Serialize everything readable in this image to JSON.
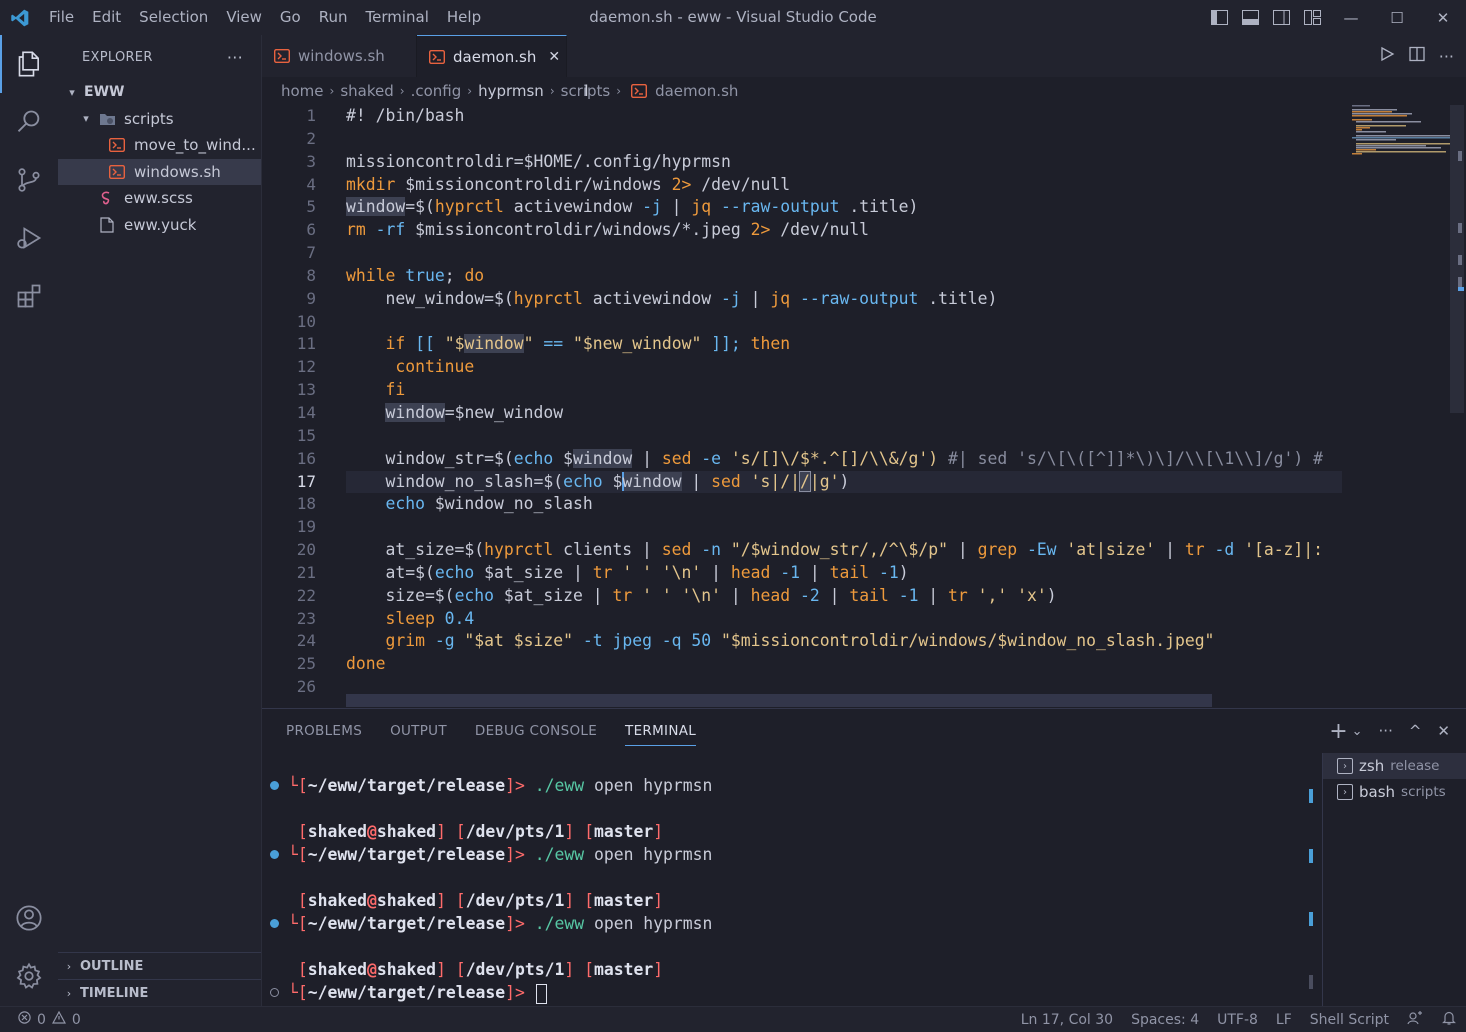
{
  "window": {
    "title": "daemon.sh - eww - Visual Studio Code",
    "menu": [
      "File",
      "Edit",
      "Selection",
      "View",
      "Go",
      "Run",
      "Terminal",
      "Help"
    ],
    "controls": {
      "minimize": "—",
      "maximize": "☐",
      "close": "✕"
    }
  },
  "sidebar": {
    "header": "EXPLORER",
    "more": "···",
    "root": "EWW",
    "items": [
      {
        "label": "scripts",
        "type": "folder"
      },
      {
        "label": "move_to_wind...",
        "type": "shell"
      },
      {
        "label": "windows.sh",
        "type": "shell"
      },
      {
        "label": "eww.scss",
        "type": "sass"
      },
      {
        "label": "eww.yuck",
        "type": "file"
      }
    ],
    "sections": [
      "OUTLINE",
      "TIMELINE"
    ]
  },
  "tabs": [
    {
      "label": "windows.sh",
      "active": false
    },
    {
      "label": "daemon.sh",
      "active": true,
      "close": "✕"
    }
  ],
  "breadcrumb": [
    "home",
    "shaked",
    ".config",
    "hyprmsn",
    "scripts",
    "daemon.sh"
  ],
  "editor": {
    "current_line": 17,
    "lines": [
      "1",
      "2",
      "3",
      "4",
      "5",
      "6",
      "7",
      "8",
      "9",
      "10",
      "11",
      "12",
      "13",
      "14",
      "15",
      "16",
      "17",
      "18",
      "19",
      "20",
      "21",
      "22",
      "23",
      "24",
      "25",
      "26"
    ],
    "code": {
      "l1": "#! /bin/bash",
      "l3": "missioncontroldir=$HOME/.config/hyprmsn",
      "l4_cmd": "mkdir",
      "l4_rest": " $missioncontroldir/windows ",
      "l4_redir": "2>",
      "l4_tail": " /dev/null",
      "l5_var": "window",
      "l5_eq": "=$(",
      "l5_cmd": "hyprctl",
      "l5_a1": " activewindow ",
      "l5_flag": "-j",
      "l5_pipe": " | ",
      "l5_jq": "jq",
      "l5_flag2": " --raw-output",
      "l5_tail": " .title)",
      "l6_cmd": "rm",
      "l6_flag": " -rf",
      "l6_rest": " $missioncontroldir/windows/*.jpeg ",
      "l6_redir": "2>",
      "l6_tail": " /dev/null",
      "l8_while": "while",
      "l8_true": " true",
      "l8_semi": "; ",
      "l8_do": "do",
      "l9_pre": "    new_window=$(",
      "l9_cmd": "hyprctl",
      "l9_a1": " activewindow ",
      "l9_flag": "-j",
      "l9_pipe": " | ",
      "l9_jq": "jq",
      "l9_flag2": " --raw-output",
      "l9_tail": " .title)",
      "l11_if": "    if",
      "l11_b1": " [[ ",
      "l11_s1": "\"$",
      "l11_hl": "window",
      "l11_s2": "\"",
      "l11_op": " == ",
      "l11_s3": "\"$new_window\"",
      "l11_b2": " ]]; ",
      "l11_then": "then",
      "l12": "     continue",
      "l13": "    fi",
      "l14_pre": "    ",
      "l14_hl": "window",
      "l14_tail": "=$new_window",
      "l16_pre": "    window_str=$(",
      "l16_echo": "echo",
      "l16_v": " $",
      "l16_hl": "window",
      "l16_pipe": " | ",
      "l16_sed": "sed",
      "l16_flag": " -e",
      "l16_str": " 's/[]\\/$*.^[]/\\\\&/g')",
      "l16_comment": " #| sed 's/\\[\\([^]]*\\)\\]/\\\\[\\1\\\\]/g') #",
      "l17_pre": "    window_no_slash=$(",
      "l17_echo": "echo",
      "l17_v": " $",
      "l17_hl": "window",
      "l17_pipe": " | ",
      "l17_sed": "sed",
      "l17_str": " 's|/|",
      "l17_hl2": "/",
      "l17_str2": "|g'",
      "l17_tail": ")",
      "l18_echo": "    echo",
      "l18_tail": " $window_no_slash",
      "l20_pre": "    at_size=$(",
      "l20_cmd": "hyprctl",
      "l20_a1": " clients",
      "l20_pipe": " | ",
      "l20_sed": "sed",
      "l20_flag": " -n",
      "l20_str": " \"/$window_str/,/^\\$/p\"",
      "l20_pipe2": " | ",
      "l20_grep": "grep",
      "l20_flag2": " -Ew",
      "l20_str2": " 'at|size'",
      "l20_pipe3": " | ",
      "l20_tr": "tr",
      "l20_flag3": " -d",
      "l20_str3": " '[a-z]|:",
      "l21_pre": "    at=$(",
      "l21_echo": "echo",
      "l21_v": " $at_size",
      "l21_pipe": " | ",
      "l21_tr": "tr",
      "l21_str": " ' ' '\\n'",
      "l21_pipe2": " | ",
      "l21_head": "head",
      "l21_n": " -1",
      "l21_pipe3": " | ",
      "l21_tail": "tail",
      "l21_n2": " -1",
      "l21_end": ")",
      "l22_pre": "    size=$(",
      "l22_echo": "echo",
      "l22_v": " $at_size",
      "l22_pipe": " | ",
      "l22_tr": "tr",
      "l22_str": " ' ' '\\n'",
      "l22_pipe2": " | ",
      "l22_head": "head",
      "l22_n": " -2",
      "l22_pipe3": " | ",
      "l22_tail": "tail",
      "l22_n2": " -1",
      "l22_pipe4": " | ",
      "l22_tr2": "tr",
      "l22_str2": " ',' 'x'",
      "l22_end": ")",
      "l23_sleep": "    sleep",
      "l23_n": " 0.4",
      "l24_grim": "    grim",
      "l24_f1": " -g",
      "l24_s1": " \"$at $size\"",
      "l24_f2": " -t",
      "l24_jpeg": " jpeg",
      "l24_f3": " -q",
      "l24_n": " 50",
      "l24_s2": " \"$missioncontroldir/windows/$window_no_slash.jpeg\"",
      "l25": "done"
    }
  },
  "panel": {
    "tabs": [
      "PROBLEMS",
      "OUTPUT",
      "DEBUG CONSOLE",
      "TERMINAL"
    ],
    "active_tab": "TERMINAL",
    "actions": {
      "add": "+",
      "dropdown": "⌄",
      "more": "···",
      "maximize": "^",
      "close": "✕"
    },
    "terminal_lines": {
      "p_open": "└[",
      "path": "~/eww/target/release",
      "p_close": "]>",
      "cmd_bin": " ./eww",
      "cmd_args": " open hyprmsn",
      "b_open": "[",
      "user": "shaked",
      "at": "@",
      "host": "shaked",
      "b_close": "]",
      "tty_open": " [",
      "tty": "/dev/pts/1",
      "tty_close": "]",
      "branch_open": " [",
      "branch": "master",
      "branch_close": "]",
      "cursor": " "
    },
    "terminal_list": [
      {
        "shell": "zsh",
        "name": "release",
        "selected": true
      },
      {
        "shell": "bash",
        "name": "scripts",
        "selected": false
      }
    ]
  },
  "statusbar": {
    "errors": "0",
    "warnings": "0",
    "position": "Ln 17, Col 30",
    "spaces": "Spaces: 4",
    "encoding": "UTF-8",
    "eol": "LF",
    "language": "Shell Script"
  },
  "colors": {
    "accent": "#5aa0e6",
    "keyword": "#ee9a3c",
    "function": "#69b7f0",
    "string": "#e3c58c",
    "shell_icon": "#e8623f"
  }
}
